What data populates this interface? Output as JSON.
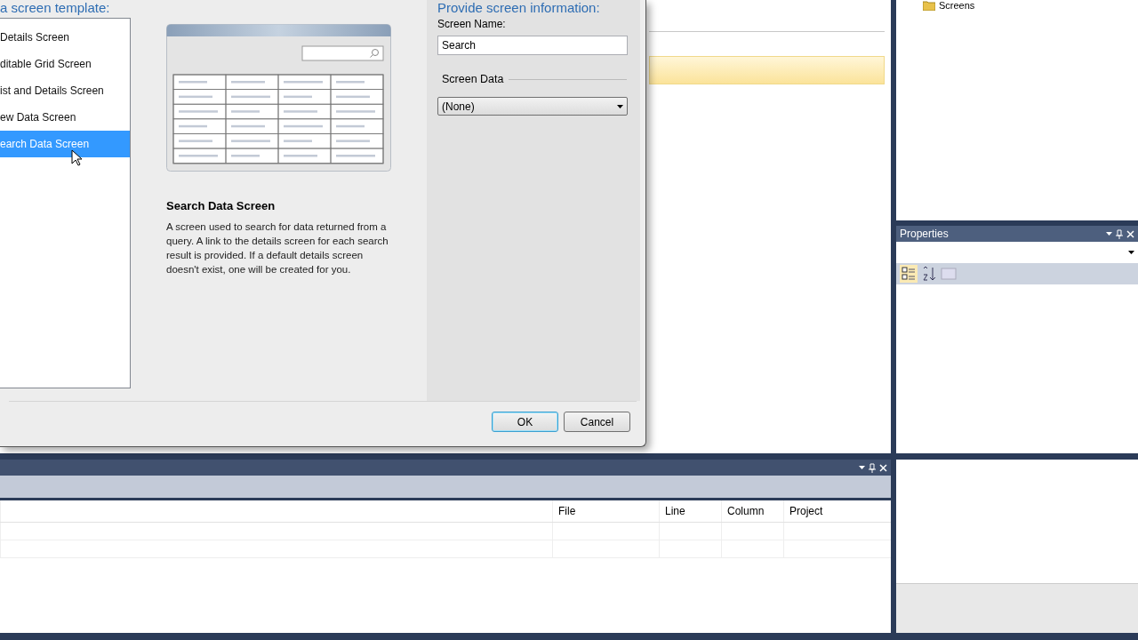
{
  "dialog": {
    "left_heading": "a screen template:",
    "right_heading": "Provide screen information:",
    "templates": [
      {
        "label": "Details Screen",
        "selected": false
      },
      {
        "label": "ditable Grid Screen",
        "selected": false
      },
      {
        "label": "ist and Details Screen",
        "selected": false
      },
      {
        "label": "ew Data Screen",
        "selected": false
      },
      {
        "label": "earch Data Screen",
        "selected": true
      }
    ],
    "preview_title": "Search Data Screen",
    "description": "A screen used to search for data returned from a query.  A link to the details screen for each search result is provided.  If a default details screen doesn't exist, one will be created for you.",
    "screen_name_label": "Screen Name:",
    "screen_name_value": "Search",
    "screen_data_label": "Screen Data",
    "screen_data_value": "(None)",
    "buttons": [
      {
        "label": "OK",
        "default": true
      },
      {
        "label": "Cancel",
        "default": false
      }
    ]
  },
  "solution_explorer": {
    "items": [
      {
        "label": "Screens"
      }
    ]
  },
  "properties": {
    "title": "Properties"
  },
  "error_list": {
    "columns": [
      "File",
      "Line",
      "Column",
      "Project"
    ]
  }
}
